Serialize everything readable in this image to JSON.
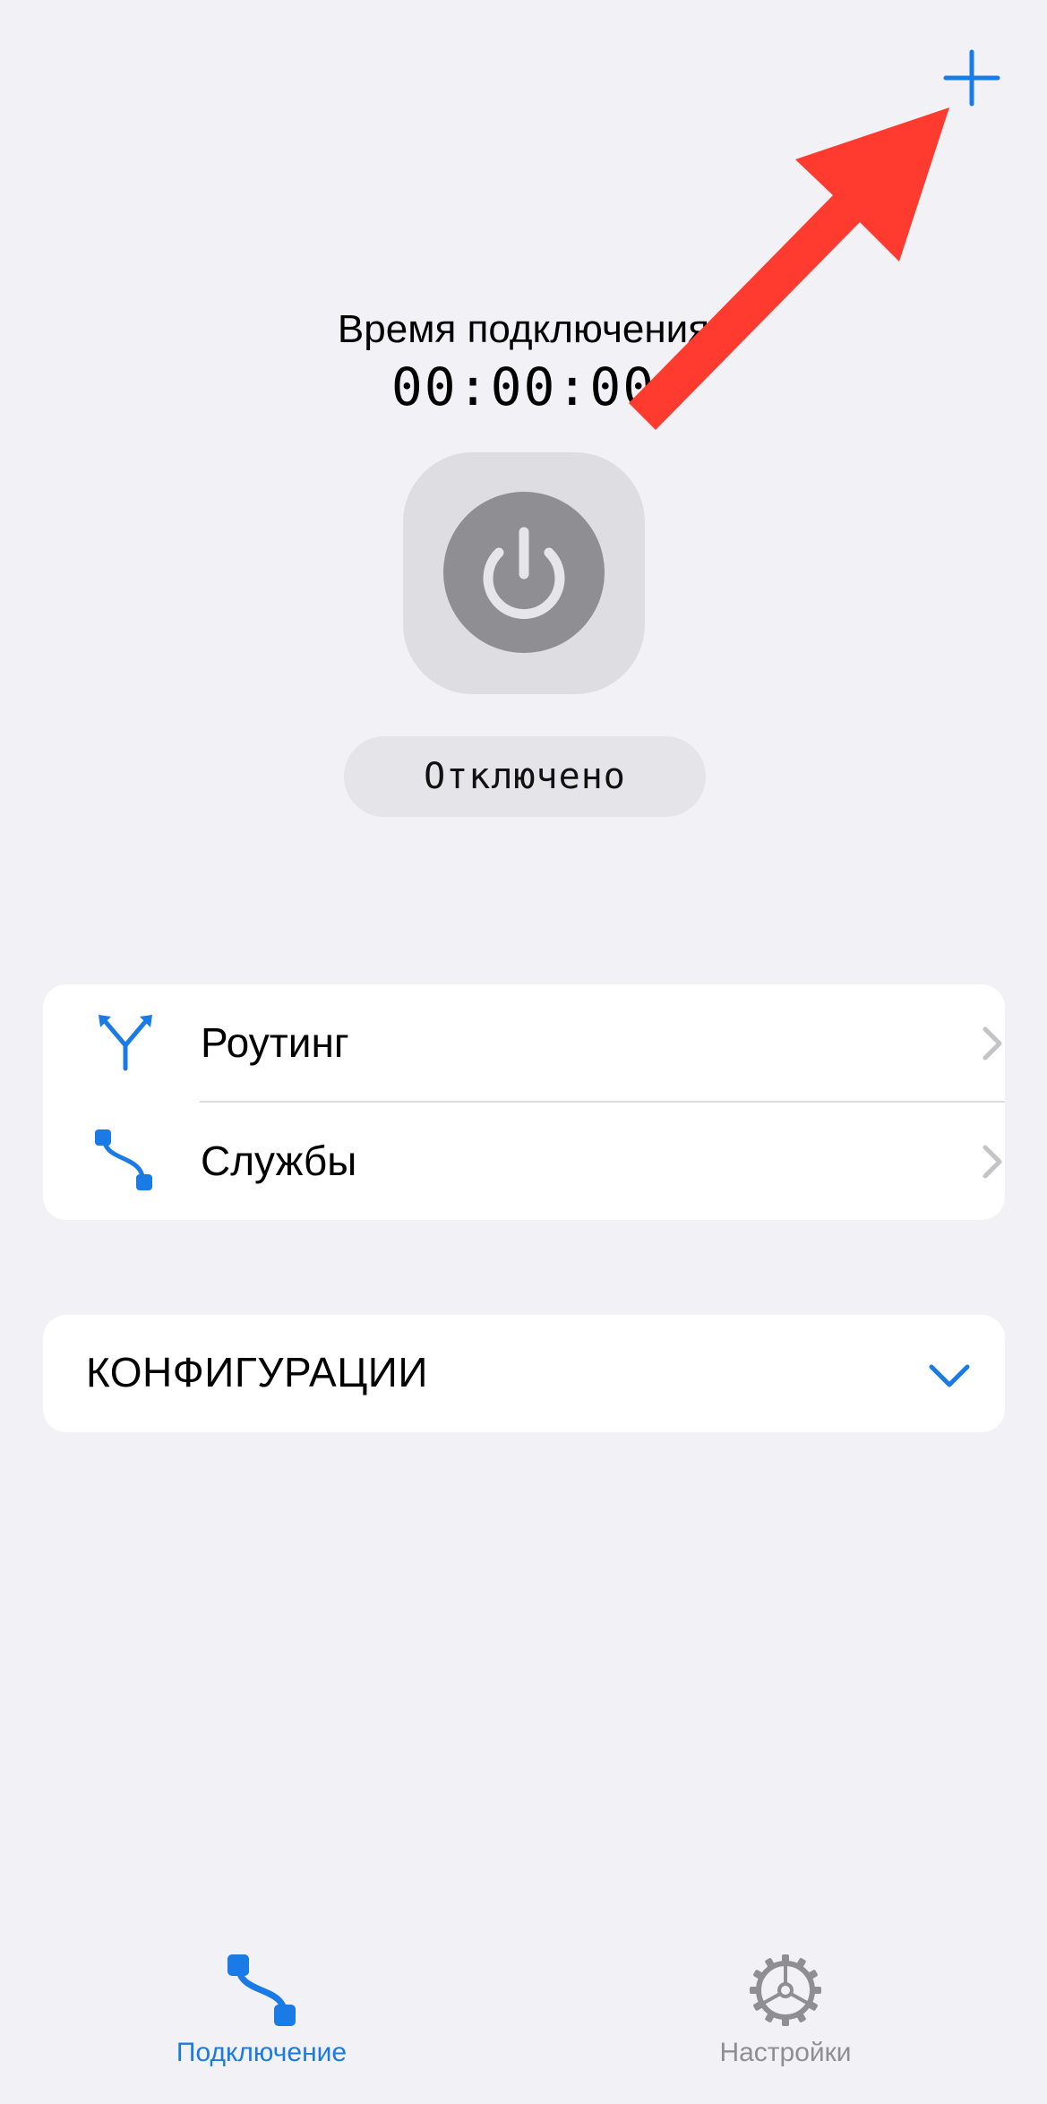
{
  "header": {
    "add_button_icon": "plus-icon"
  },
  "connection": {
    "timer_label": "Время подключения",
    "timer_value": "00:00:00",
    "power_icon": "power-icon",
    "status": "Отключено"
  },
  "menu": {
    "items": [
      {
        "label": "Роутинг",
        "icon": "routing-icon"
      },
      {
        "label": "Службы",
        "icon": "services-icon"
      }
    ]
  },
  "configurations": {
    "title": "КОНФИГУРАЦИИ",
    "expanded": false
  },
  "tabbar": {
    "tabs": [
      {
        "label": "Подключение",
        "icon": "connection-icon",
        "active": true
      },
      {
        "label": "Настройки",
        "icon": "gear-icon",
        "active": false
      }
    ]
  },
  "colors": {
    "accent": "#1a7ae6",
    "annotation_arrow": "#ff3b30",
    "inactive": "#8e8e93",
    "background": "#f2f1f6"
  }
}
